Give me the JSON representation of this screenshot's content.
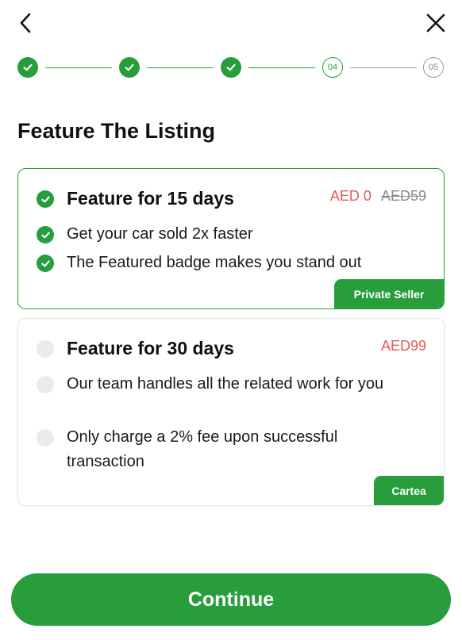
{
  "header": {
    "back_icon": "chevron-left-icon",
    "close_icon": "close-icon"
  },
  "stepper": {
    "current_step": 4,
    "total_steps": 5,
    "steps": [
      {
        "state": "done",
        "label": ""
      },
      {
        "state": "done",
        "label": ""
      },
      {
        "state": "done",
        "label": ""
      },
      {
        "state": "current",
        "label": "04"
      },
      {
        "state": "todo",
        "label": "05"
      }
    ],
    "accent_color": "#279d3b",
    "inactive_color": "#9a9a9a"
  },
  "page_title": "Feature The Listing",
  "options": [
    {
      "title": "Feature for 15 days",
      "price": "AED 0",
      "original_price": "AED59",
      "selected": true,
      "features": [
        "Get your car sold 2x faster",
        "The Featured badge makes you stand out"
      ],
      "badge": "Private Seller"
    },
    {
      "title": "Feature for 30 days",
      "price": "AED99",
      "selected": false,
      "features": [
        "Our team handles all the related work for you",
        "Only charge a 2% fee upon successful transaction"
      ],
      "badge": "Cartea"
    }
  ],
  "continue_label": "Continue",
  "colors": {
    "brand_green": "#279d3b",
    "price_red": "#e35a55",
    "muted_grey": "#8a8a8a"
  }
}
